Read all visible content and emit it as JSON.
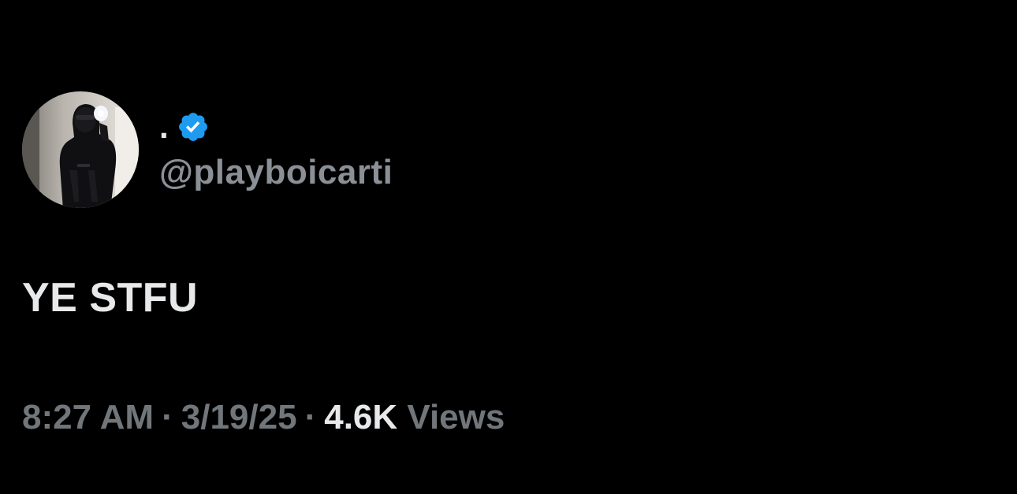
{
  "tweet": {
    "author": {
      "display_name": ".",
      "handle": "@playboicarti",
      "verified": true,
      "verified_icon": "verified-badge-icon",
      "verified_color": "#1d9bf0",
      "avatar_icon": "profile-photo"
    },
    "text": "YE STFU",
    "meta": {
      "time": "8:27 AM",
      "separator": "·",
      "date": "3/19/25",
      "views_count": "4.6K",
      "views_label": "Views"
    }
  },
  "colors": {
    "background": "#000000",
    "primary_text": "#e7e9ea",
    "secondary_text": "#71767b",
    "accent": "#1d9bf0"
  }
}
